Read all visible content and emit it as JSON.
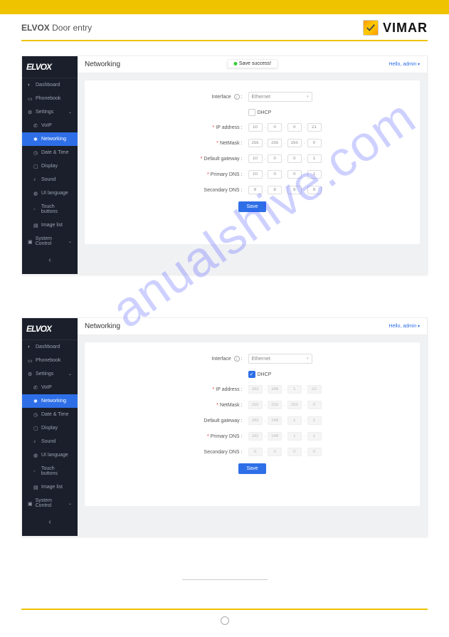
{
  "header": {
    "product_line": "ELVOX",
    "product_sub": "Door entry",
    "vendor": "VIMAR"
  },
  "watermark": "anualshive.com",
  "sidebar": {
    "logo": "ELVOX",
    "items": [
      {
        "label": "Dashboard"
      },
      {
        "label": "Phonebook"
      },
      {
        "label": "Settings"
      },
      {
        "label": "VoIP"
      },
      {
        "label": "Networking"
      },
      {
        "label": "Date & Time"
      },
      {
        "label": "Display"
      },
      {
        "label": "Sound"
      },
      {
        "label": "UI language"
      },
      {
        "label": "Touch buttons"
      },
      {
        "label": "Image list"
      },
      {
        "label": "System Control"
      }
    ],
    "collapse": "‹"
  },
  "shot1": {
    "title": "Networking",
    "save_success": "Save success!",
    "hello": "Hello, admin",
    "form": {
      "interface_label": "Interface",
      "interface_value": "Ethernet",
      "dhcp_label": "DHCP",
      "dhcp_checked": false,
      "rows": [
        {
          "label": "IP address",
          "required": true,
          "values": [
            "10",
            "0",
            "0",
            "21"
          ]
        },
        {
          "label": "NetMask",
          "required": true,
          "values": [
            "255",
            "255",
            "255",
            "0"
          ]
        },
        {
          "label": "Default gateway",
          "required": true,
          "values": [
            "10",
            "0",
            "0",
            "1"
          ]
        },
        {
          "label": "Primary DNS",
          "required": true,
          "values": [
            "10",
            "0",
            "0",
            "1"
          ]
        },
        {
          "label": "Secondary DNS",
          "required": false,
          "values": [
            "8",
            "8",
            "8",
            "8"
          ]
        }
      ],
      "save": "Save"
    }
  },
  "shot2": {
    "title": "Networking",
    "hello": "Hello, admin",
    "form": {
      "interface_label": "Interface",
      "interface_value": "Ethernet",
      "dhcp_label": "DHCP",
      "dhcp_checked": true,
      "rows": [
        {
          "label": "IP address",
          "required": true,
          "values": [
            "192",
            "168",
            "1",
            "22"
          ]
        },
        {
          "label": "NetMask",
          "required": true,
          "values": [
            "255",
            "255",
            "255",
            "0"
          ]
        },
        {
          "label": "Default gateway",
          "required": false,
          "values": [
            "192",
            "168",
            "1",
            "1"
          ]
        },
        {
          "label": "Primary DNS",
          "required": true,
          "values": [
            "192",
            "168",
            "1",
            "1"
          ]
        },
        {
          "label": "Secondary DNS",
          "required": false,
          "values": [
            "0",
            "0",
            "0",
            "0"
          ]
        }
      ],
      "save": "Save"
    }
  }
}
